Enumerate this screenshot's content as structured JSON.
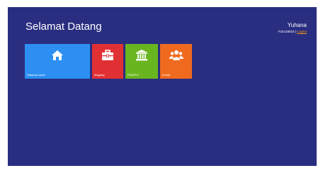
{
  "header": {
    "title": "Selamat Datang"
  },
  "user": {
    "name": "Yuhana",
    "id": "F1E119023",
    "separator": " | ",
    "logout_label": "Logout"
  },
  "colors": {
    "background": "#2a2e80",
    "tile_1": "#2d8ff2",
    "tile_2": "#e13034",
    "tile_3": "#69b51f",
    "tile_4": "#ef6a1f",
    "logout_link": "#f39c12"
  },
  "tiles": [
    {
      "label": "Halaman Awal",
      "icon": "home-icon"
    },
    {
      "label": "Magang",
      "icon": "briefcase-icon"
    },
    {
      "label": "PRUPLP",
      "icon": "institution-icon"
    },
    {
      "label": "Kelola",
      "icon": "users-icon"
    }
  ]
}
